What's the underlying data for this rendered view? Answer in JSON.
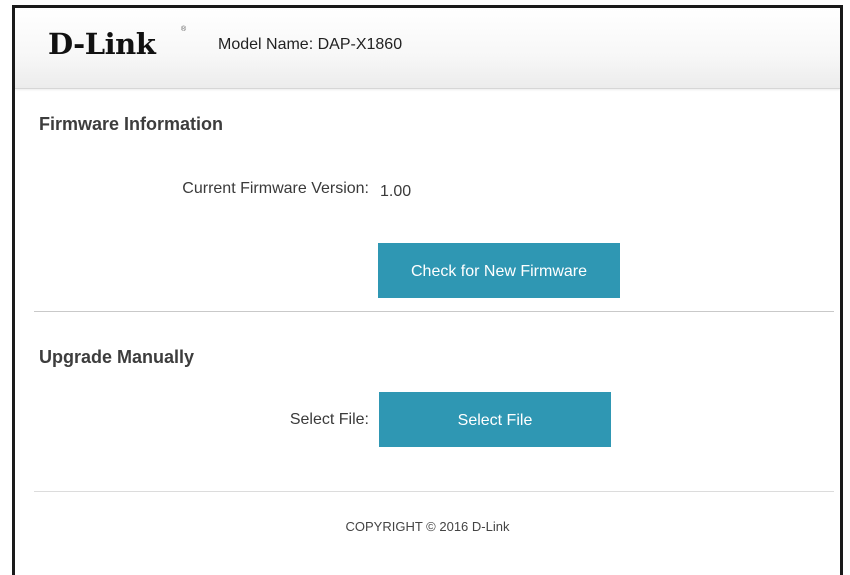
{
  "header": {
    "logo_text": "D-Link",
    "logo_mark": "®",
    "model_label": "Model Name: DAP-X1860"
  },
  "firmware_section": {
    "title": "Firmware Information",
    "current_version_label": "Current Firmware Version:",
    "current_version_value": "1.00",
    "check_button_label": "Check for New Firmware"
  },
  "upgrade_section": {
    "title": "Upgrade Manually",
    "select_file_label": "Select File:",
    "select_file_button_label": "Select File"
  },
  "footer": {
    "copyright": "COPYRIGHT © 2016 D-Link"
  },
  "colors": {
    "accent_button": "#2f97b3",
    "frame_border": "#1a1a1a",
    "section_title": "#3d3d3d"
  }
}
